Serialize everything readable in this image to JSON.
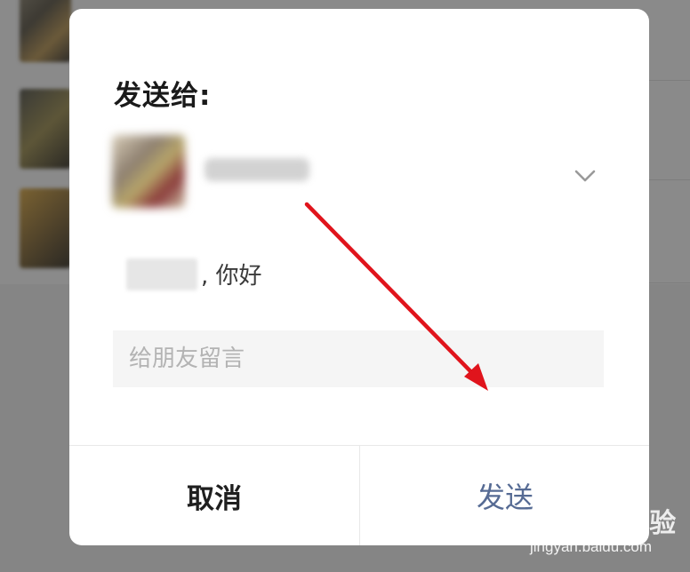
{
  "dialog": {
    "title": "发送给:",
    "recipient_name": "",
    "greeting_name": "",
    "greeting_text": ", 你好",
    "message_placeholder": "给朋友留言",
    "message_value": "",
    "cancel_label": "取消",
    "send_label": "发送"
  },
  "watermark": {
    "brand": "Baidu经验",
    "url": "jingyan.baidu.com"
  },
  "colors": {
    "overlay": "#8a8a8a",
    "dialog_bg": "#ffffff",
    "send_text": "#566b94",
    "cancel_text": "#1f1f1f",
    "annotation_arrow": "#e0141c",
    "input_bg": "#f5f5f5"
  },
  "icons": {
    "chevron": "chevron-down-icon",
    "annotation": "red-arrow-annotation"
  }
}
